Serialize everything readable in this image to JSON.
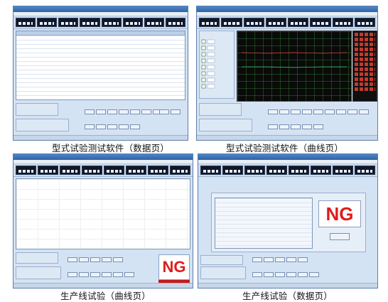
{
  "caption_top_left": "型式试验测试软件（数据页）",
  "caption_top_right": "型式试验测试软件（曲线页）",
  "caption_bottom_left": "生产线试验（曲线页）",
  "caption_bottom_right": "生产线试验（数据页）",
  "result_bottom_left": "NG",
  "result_bottom_right": "NG"
}
